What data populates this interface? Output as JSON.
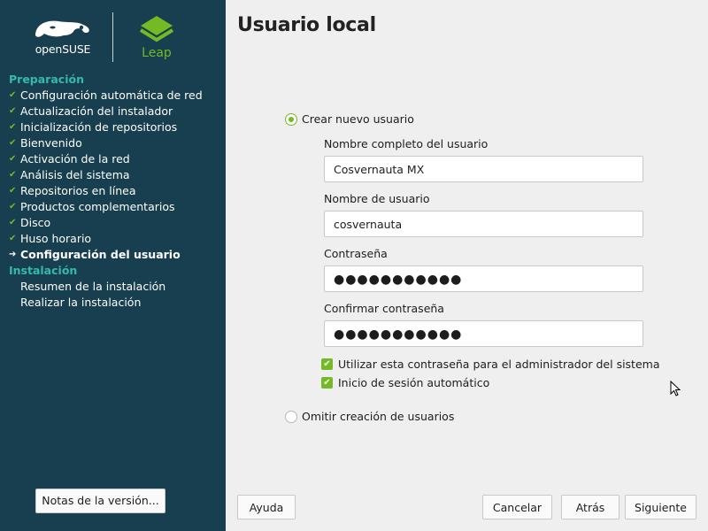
{
  "brand": {
    "opensuse_text": "openSUSE",
    "leap_text": "Leap",
    "chameleon_icon": "opensuse-chameleon-icon",
    "leap_icon": "leap-cube-icon"
  },
  "sidebar": {
    "groups": [
      {
        "title": "Preparación",
        "items": [
          {
            "label": "Configuración automática de red",
            "state": "done"
          },
          {
            "label": "Actualización del instalador",
            "state": "done"
          },
          {
            "label": "Inicialización de repositorios",
            "state": "done"
          },
          {
            "label": "Bienvenido",
            "state": "done"
          },
          {
            "label": "Activación de la red",
            "state": "done"
          },
          {
            "label": "Análisis del sistema",
            "state": "done"
          },
          {
            "label": "Repositorios en línea",
            "state": "done"
          },
          {
            "label": "Productos complementarios",
            "state": "done"
          },
          {
            "label": "Disco",
            "state": "done"
          },
          {
            "label": "Huso horario",
            "state": "done"
          },
          {
            "label": "Configuración del usuario",
            "state": "current"
          }
        ]
      },
      {
        "title": "Instalación",
        "items": [
          {
            "label": "Resumen de la instalación",
            "state": "pending"
          },
          {
            "label": "Realizar la instalación",
            "state": "pending"
          }
        ]
      }
    ],
    "notes_button": "Notas de la versión..."
  },
  "main": {
    "title": "Usuario local",
    "create_user_option": "Crear nuevo usuario",
    "fullname_label": "Nombre completo del usuario",
    "fullname_value": "Cosvernauta MX",
    "username_label": "Nombre de usuario",
    "username_value": "cosvernauta",
    "password_label": "Contraseña",
    "password_value": "●●●●●●●●●●●",
    "confirm_label": "Confirmar contraseña",
    "confirm_value": "●●●●●●●●●●●",
    "admin_password_checkbox": "Utilizar esta contraseña para el administrador del sistema",
    "autologin_checkbox": "Inicio de sesión automático",
    "skip_option": "Omitir creación de usuarios"
  },
  "footer": {
    "help": "Ayuda",
    "cancel": "Cancelar",
    "back": "Atrás",
    "next": "Siguiente"
  },
  "colors": {
    "sidebar_bg": "#173f4f",
    "accent_green": "#73ba25",
    "heading_teal": "#35b9ab",
    "content_bg": "#efefef"
  }
}
